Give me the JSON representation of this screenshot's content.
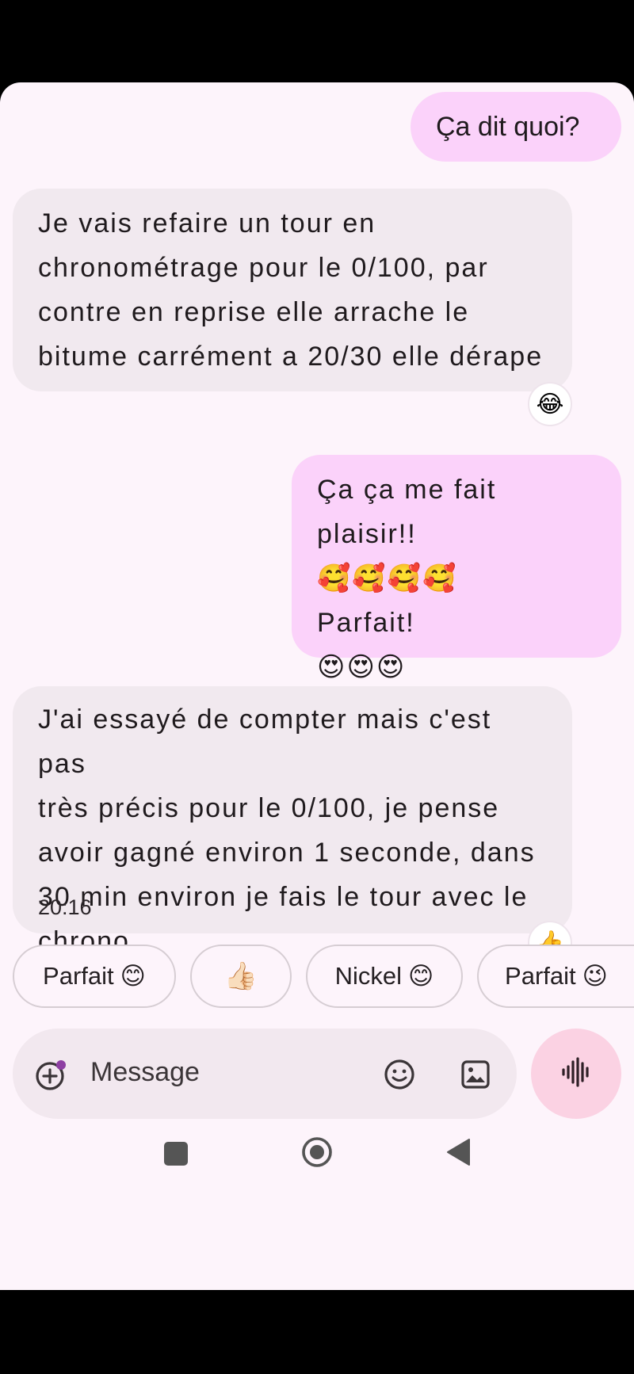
{
  "messages": [
    {
      "direction": "out",
      "text": "Ça dit quoi?"
    },
    {
      "direction": "in",
      "lines": [
        "Je vais refaire un tour en",
        "chronométrage pour le 0/100, par",
        "contre en reprise elle arrache le",
        "bitume carrément a 20/30 elle dérape"
      ],
      "reaction": "😂"
    },
    {
      "direction": "out",
      "lines": [
        "Ça ça me fait plaisir!!",
        "🥰🥰🥰🥰",
        "Parfait!",
        "😍😍😍"
      ]
    },
    {
      "direction": "in",
      "lines": [
        "J'ai essayé de compter mais c'est pas",
        "très précis pour le 0/100, je pense",
        "avoir gagné environ 1 seconde, dans",
        "30 min environ je fais le tour avec le",
        "chrono"
      ],
      "reaction": "👍"
    }
  ],
  "timestamp": "20:16",
  "suggestions": [
    {
      "label": "Parfait",
      "emoji": "😊"
    },
    {
      "label": "",
      "emoji": "👍🏻"
    },
    {
      "label": "Nickel",
      "emoji": "😊"
    },
    {
      "label": "Parfait",
      "emoji": "😉"
    }
  ],
  "composer": {
    "placeholder": "Message"
  },
  "icons": {
    "add": "add-circle-icon",
    "emoji": "smiley-icon",
    "gallery": "image-icon",
    "voice": "waveform-icon"
  },
  "nav": {
    "recents": "square-icon",
    "home": "circle-icon",
    "back": "triangle-back-icon"
  },
  "colors": {
    "outgoing_bubble": "#fbd2fa",
    "incoming_bubble": "#f1e9ef",
    "background": "#fdf4fb",
    "voice_button": "#fbd2e3"
  }
}
